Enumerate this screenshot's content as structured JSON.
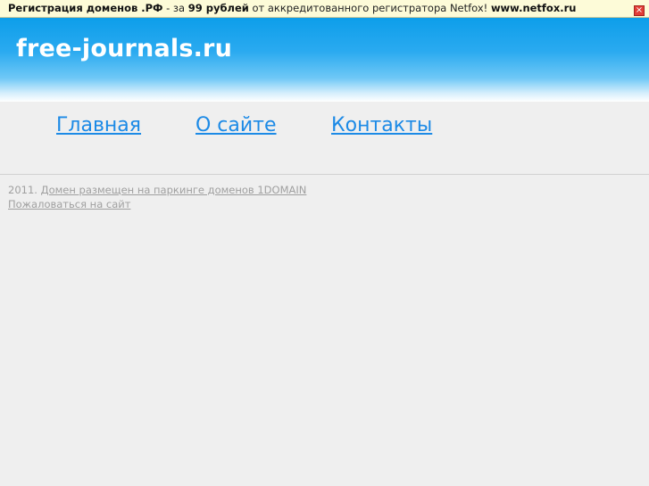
{
  "promo_bar": {
    "part1_bold": "Регистрация доменов .РФ",
    "part2": " - за ",
    "part3_bold": "99 рублей",
    "part4": " от аккредитованного регистратора Netfox! ",
    "part5_bold": "www.netfox.ru",
    "close_glyph": "×"
  },
  "header": {
    "site_title": "free-journals.ru"
  },
  "nav": {
    "items": [
      {
        "label": "Главная"
      },
      {
        "label": "О сайте"
      },
      {
        "label": "Контакты"
      }
    ]
  },
  "footer": {
    "year": "2011. ",
    "parking_link": "Домен размещен на паркинге доменов 1DOMAIN",
    "complain_link": "Пожаловаться на сайт"
  },
  "colors": {
    "header_top": "#0d9eea",
    "link_blue": "#1c8ae6",
    "promo_bg": "#fdfbd8",
    "page_bg": "#efefef"
  }
}
